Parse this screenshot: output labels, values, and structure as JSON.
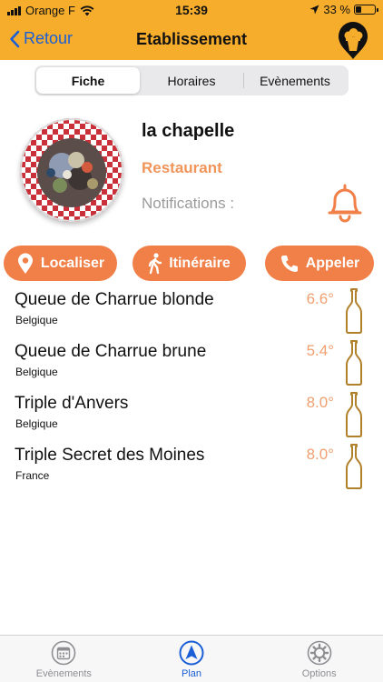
{
  "status_bar": {
    "carrier": "Orange F",
    "time": "15:39",
    "battery": "33 %",
    "battery_level": 0.33
  },
  "nav": {
    "back_label": "Retour",
    "title": "Etablissement"
  },
  "segments": [
    {
      "label": "Fiche",
      "active": true
    },
    {
      "label": "Horaires",
      "active": false
    },
    {
      "label": "Evènements",
      "active": false
    }
  ],
  "establishment": {
    "name": "la chapelle",
    "type": "Restaurant",
    "notifications_label": "Notifications :"
  },
  "actions": {
    "locate": "Localiser",
    "route": "Itinéraire",
    "call": "Appeler"
  },
  "beers": [
    {
      "name": "Queue de Charrue blonde",
      "country": "Belgique",
      "degree": "6.6°"
    },
    {
      "name": "Queue de Charrue brune",
      "country": "Belgique",
      "degree": "5.4°"
    },
    {
      "name": "Triple d'Anvers",
      "country": "Belgique",
      "degree": "8.0°"
    },
    {
      "name": "Triple Secret des Moines",
      "country": "France",
      "degree": "8.0°"
    }
  ],
  "tabbar": [
    {
      "label": "Evènements",
      "icon": "calendar-icon",
      "active": false
    },
    {
      "label": "Plan",
      "icon": "navigation-arrow-icon",
      "active": true
    },
    {
      "label": "Options",
      "icon": "gear-icon",
      "active": false
    }
  ],
  "colors": {
    "header": "#f7ad2c",
    "accent": "#f07f48",
    "link_blue": "#1a5fd6",
    "bottle": "#b0802a"
  }
}
